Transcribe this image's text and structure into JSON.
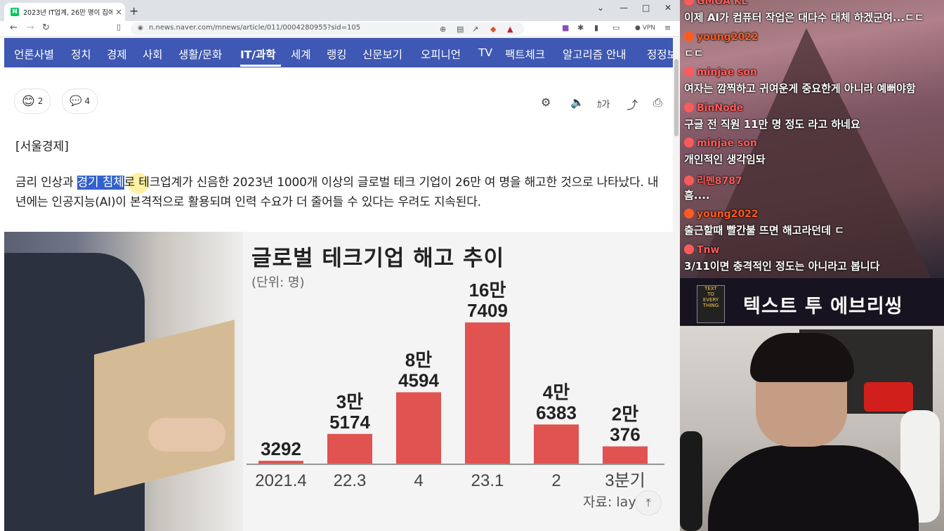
{
  "browser": {
    "tab_title": "2023년 IT업계, 26만 명이 집에 ...",
    "favicon": "N",
    "url": "n.news.naver.com/mnews/article/011/0004280955?sid=105",
    "vpn_label": "VPN"
  },
  "nav": {
    "items": [
      "언론사별",
      "정치",
      "경제",
      "사회",
      "생활/문화",
      "IT/과학",
      "세계",
      "랭킹",
      "신문보기",
      "오피니언",
      "TV",
      "팩트체크",
      "알고리즘 안내",
      "정정보도"
    ],
    "active": "IT/과학",
    "bg_color": "#3e58b3"
  },
  "article": {
    "reaction_count": "2",
    "comment_count": "4",
    "press": "[서울경제]",
    "para_before": "금리 인상과 ",
    "para_highlight": "경기 침체",
    "para_after": "로 테크업계가 신음한 2023년 1000개 이상의 글로벌 테크 기업이 26만 여 명을 해고한 것으로 나타났다. 내년에는 인공지능(AI)이 본격적으로 활용되며 인력 수요가 더 줄어들 수 있다는 우려도 지속된다.",
    "tool_font_label": "가"
  },
  "chart_data": {
    "type": "bar",
    "title": "글로벌 테크기업 해고 추이",
    "unit": "(단위: 명)",
    "categories": [
      "2021.4",
      "22.3",
      "4",
      "23.1",
      "2",
      "3분기"
    ],
    "values": [
      3292,
      35174,
      84594,
      167409,
      46383,
      20376
    ],
    "value_labels": [
      [
        "3292"
      ],
      [
        "3만",
        "5174"
      ],
      [
        "8만",
        "4594"
      ],
      [
        "16만",
        "7409"
      ],
      [
        "4만",
        "6383"
      ],
      [
        "2만",
        "376"
      ]
    ],
    "source": "자료: lay",
    "bar_color": "#e05350",
    "ylim": [
      0,
      175000
    ]
  },
  "chat": {
    "messages": [
      {
        "user": "GMOA KL",
        "text": "이제 AI가 컴퓨터 작업은 대다수 대체 하겠군여...ㄷㄷ",
        "color": "#ff5a5a"
      },
      {
        "user": "young2022",
        "text": "ㄷㄷ",
        "color": "#ff5a1f"
      },
      {
        "user": "minjae son",
        "text": "여자는 깜찍하고 귀여운게 중요한게 아니라 예뻐야함",
        "color": "#ff5a5a"
      },
      {
        "user": "BinNode",
        "text": "구글 전 직원 11만 명 정도 라고 하네요",
        "color": "#ff5a5a"
      },
      {
        "user": "minjae son",
        "text": "개인적인 생각임돠",
        "color": "#ff5a5a"
      },
      {
        "user": "리펜8787",
        "text": "흠....",
        "color": "#ff5a5a"
      },
      {
        "user": "young2022",
        "text": "출근할때 빨간불 뜨면 해고라던데 ㄷ",
        "color": "#ff5a1f"
      },
      {
        "user": "Tnw",
        "text": "3/11이면 충격적인 정도는 아니라고 봅니다",
        "color": "#ff5a5a"
      }
    ]
  },
  "banner": {
    "text": "텍스트 투 에브리씽"
  }
}
